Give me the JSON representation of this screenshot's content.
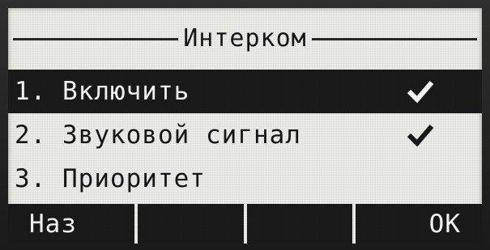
{
  "screen": {
    "title": "Интерком"
  },
  "menu": {
    "items": [
      {
        "label": "1. Включить",
        "checked": true,
        "selected": true
      },
      {
        "label": "2. Звуковой сигнал",
        "checked": true,
        "selected": false
      },
      {
        "label": "3. Приоритет",
        "checked": false,
        "selected": false
      }
    ]
  },
  "softkeys": {
    "back_label": "Наз",
    "key2_label": "",
    "key3_label": "",
    "ok_label": "ОК"
  },
  "icons": {
    "check": "checkmark-icon"
  },
  "colors": {
    "lcd_background": "#e7e7e3",
    "lcd_dark": "#1f1f1f",
    "lcd_text_inverse": "#f2f2f2"
  }
}
